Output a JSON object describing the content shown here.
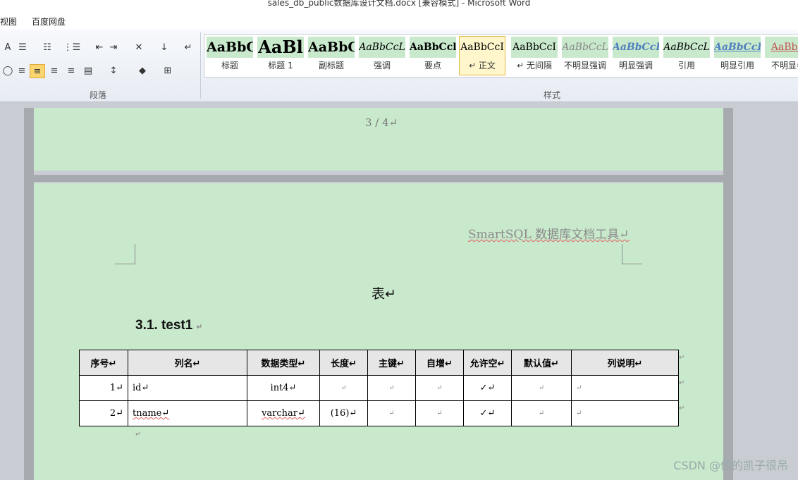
{
  "window": {
    "title": "sales_db_public数据库设计文档.docx [兼容模式] - Microsoft Word"
  },
  "menu": {
    "items": [
      "视图",
      "百度网盘"
    ]
  },
  "ribbon": {
    "paragraph_label": "段落",
    "styles_label": "样式",
    "styles": [
      {
        "sample": "AaBbC",
        "name": "标题"
      },
      {
        "sample": "AaBl",
        "name": "标题 1"
      },
      {
        "sample": "AaBbC",
        "name": "副标题"
      },
      {
        "sample": "AaBbCcL",
        "name": "强调"
      },
      {
        "sample": "AaBbCcl",
        "name": "要点"
      },
      {
        "sample": "AaBbCcI",
        "name": "↵ 正文"
      },
      {
        "sample": "AaBbCcI",
        "name": "↵ 无间隔"
      },
      {
        "sample": "AaBbCcL",
        "name": "不明显强调"
      },
      {
        "sample": "AaBbCcL",
        "name": "明显强调"
      },
      {
        "sample": "AaBbCcL",
        "name": "引用"
      },
      {
        "sample": "AaBbCcL",
        "name": "明显引用"
      },
      {
        "sample": "AaBbC",
        "name": "不明显参"
      }
    ]
  },
  "document": {
    "page_number": "3 / 4↵",
    "header_text": "SmartSQL 数据库文档工具↵",
    "heading_char": "表↵",
    "section_title": "3.1. test1",
    "table": {
      "headers": [
        "序号↵",
        "列名↵",
        "数据类型↵",
        "长度↵",
        "主键↵",
        "自增↵",
        "允许空↵",
        "默认值↵",
        "列说明↵"
      ],
      "rows": [
        [
          "1↵",
          "id↵",
          "int4↵",
          "↵",
          "↵",
          "↵",
          "✓↵",
          "↵",
          "↵"
        ],
        [
          "2↵",
          "tname↵",
          "varchar↵",
          "(16)↵",
          "↵",
          "↵",
          "✓↵",
          "↵",
          "↵"
        ]
      ]
    }
  },
  "watermark": "CSDN @你的凯子很吊"
}
